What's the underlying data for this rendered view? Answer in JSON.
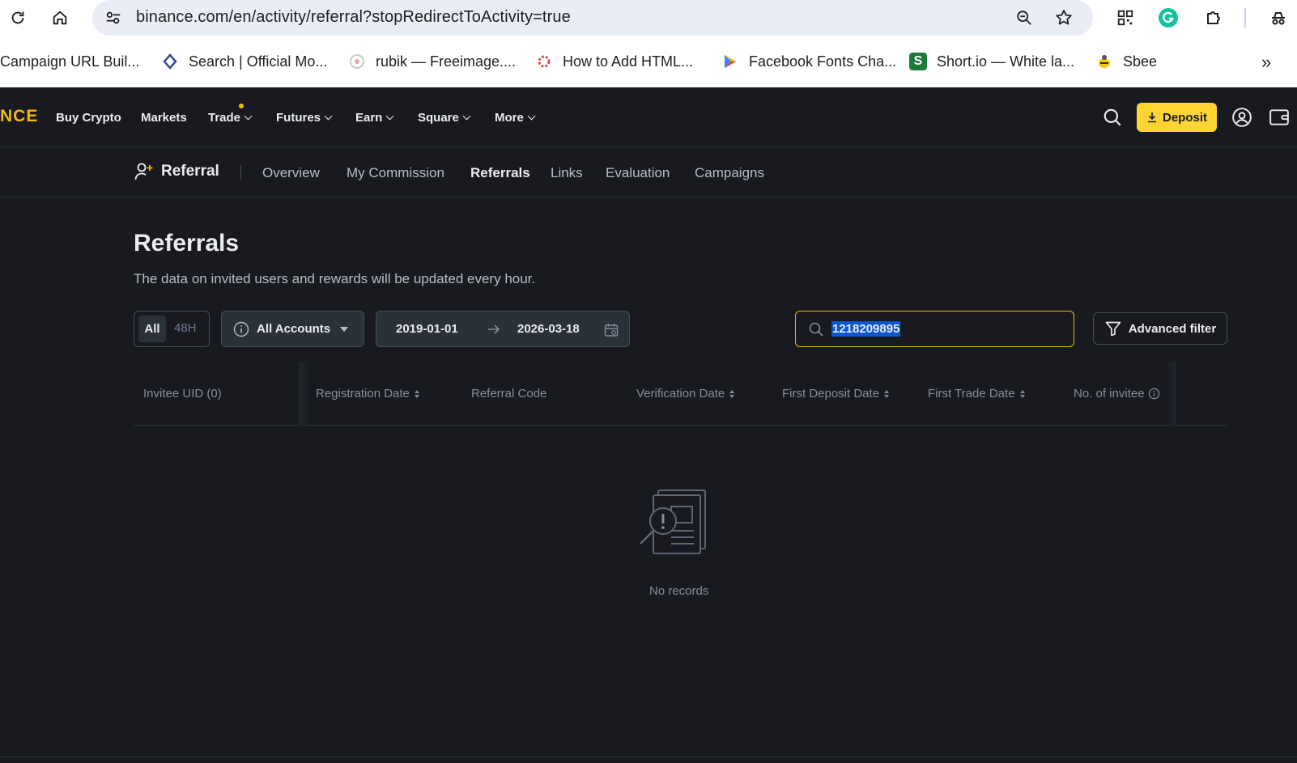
{
  "browser": {
    "url": "binance.com/en/activity/referral?stopRedirectToActivity=true",
    "bookmarks": [
      {
        "label": "Campaign URL Buil..."
      },
      {
        "label": "Search | Official Mo..."
      },
      {
        "label": "rubik — Freeimage...."
      },
      {
        "label": "How to Add HTML..."
      },
      {
        "label": "Facebook Fonts Cha..."
      },
      {
        "label": "Short.io — White la..."
      },
      {
        "label": "Sbee"
      }
    ],
    "bookmark_overflow": "»"
  },
  "topnav": {
    "logo": "NCE",
    "items": [
      {
        "label": "Buy Crypto"
      },
      {
        "label": "Markets"
      },
      {
        "label": "Trade"
      },
      {
        "label": "Futures"
      },
      {
        "label": "Earn"
      },
      {
        "label": "Square"
      },
      {
        "label": "More"
      }
    ],
    "deposit_label": "Deposit",
    "accent": "#fcd535"
  },
  "subnav": {
    "title": "Referral",
    "items": [
      {
        "label": "Overview"
      },
      {
        "label": "My Commission"
      },
      {
        "label": "Referrals"
      },
      {
        "label": "Links"
      },
      {
        "label": "Evaluation"
      },
      {
        "label": "Campaigns"
      }
    ],
    "active": "Referrals"
  },
  "page": {
    "title": "Referrals",
    "subtitle": "The data on invited users and rewards will be updated every hour."
  },
  "filters": {
    "range_all": "All",
    "range_48h": "48H",
    "account": "All Accounts",
    "date_from": "2019-01-01",
    "date_to": "2026-03-18",
    "search_value": "1218209895",
    "advanced_filter": "Advanced filter"
  },
  "table": {
    "columns": [
      {
        "label": "Invitee UID (0)"
      },
      {
        "label": "Registration Date"
      },
      {
        "label": "Referral Code"
      },
      {
        "label": "Verification Date"
      },
      {
        "label": "First Deposit Date"
      },
      {
        "label": "First Trade Date"
      },
      {
        "label": "No. of invitee"
      }
    ],
    "empty_text": "No records"
  },
  "colors": {
    "background": "#181a20",
    "brand_yellow": "#f0b90b",
    "selection_blue": "#0b57d0"
  }
}
